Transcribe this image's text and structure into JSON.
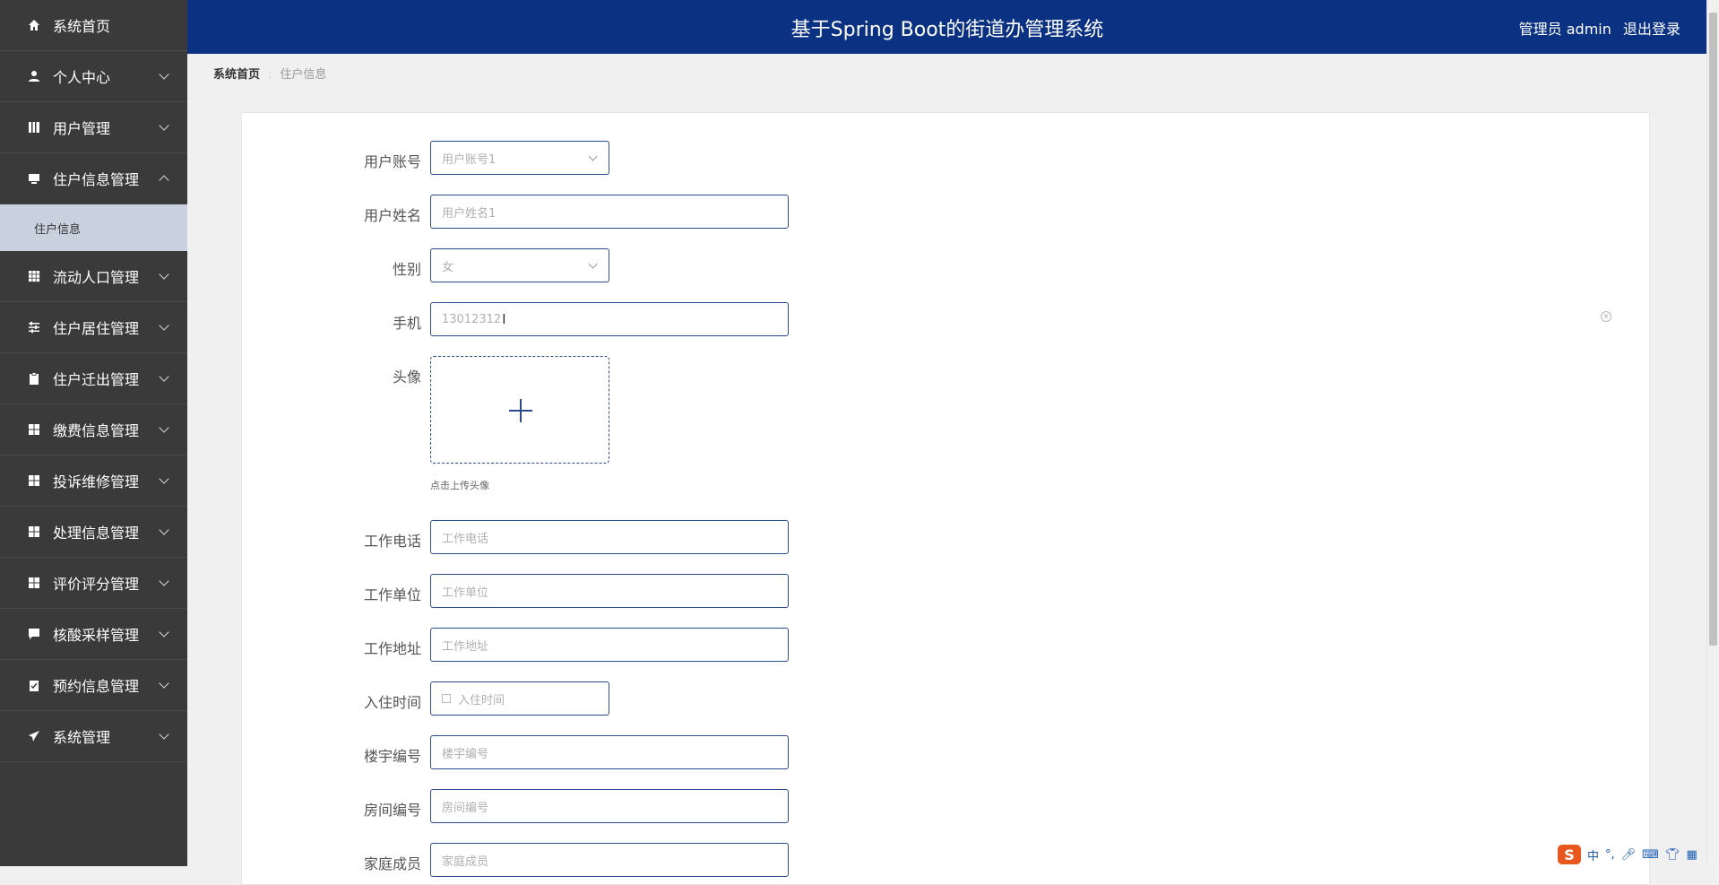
{
  "sidebar": {
    "items": [
      {
        "label": "系统首页",
        "icon": "home-icon"
      },
      {
        "label": "个人中心",
        "icon": "user-icon"
      },
      {
        "label": "用户管理",
        "icon": "book-icon"
      },
      {
        "label": "住户信息管理",
        "icon": "monitor-icon",
        "expanded": true
      },
      {
        "label": "流动人口管理",
        "icon": "grid-icon"
      },
      {
        "label": "住户居住管理",
        "icon": "sliders-icon"
      },
      {
        "label": "住户迁出管理",
        "icon": "clipboard-icon"
      },
      {
        "label": "缴费信息管理",
        "icon": "apps-icon"
      },
      {
        "label": "投诉维修管理",
        "icon": "apps-icon"
      },
      {
        "label": "处理信息管理",
        "icon": "apps-icon"
      },
      {
        "label": "评价评分管理",
        "icon": "apps-icon"
      },
      {
        "label": "核酸采样管理",
        "icon": "comment-icon"
      },
      {
        "label": "预约信息管理",
        "icon": "checklist-icon"
      },
      {
        "label": "系统管理",
        "icon": "send-icon"
      }
    ],
    "submenu": {
      "label": "住户信息"
    }
  },
  "header": {
    "title": "基于Spring Boot的街道办管理系统",
    "user_label": "管理员 admin",
    "logout_label": "退出登录",
    "bg_color": "#0b3182"
  },
  "breadcrumb": {
    "home": "系统首页",
    "current": "住户信息"
  },
  "form": {
    "account": {
      "label": "用户账号",
      "value": "用户账号1"
    },
    "name": {
      "label": "用户姓名",
      "value": "用户姓名1"
    },
    "gender": {
      "label": "性别",
      "value": "女"
    },
    "phone": {
      "label": "手机",
      "value": "13012312"
    },
    "avatar": {
      "label": "头像",
      "tip": "点击上传头像"
    },
    "work_phone": {
      "label": "工作电话",
      "placeholder": "工作电话"
    },
    "work_unit": {
      "label": "工作单位",
      "placeholder": "工作单位"
    },
    "work_address": {
      "label": "工作地址",
      "placeholder": "工作地址"
    },
    "checkin_time": {
      "label": "入住时间",
      "placeholder": "入住时间"
    },
    "building_no": {
      "label": "楼宇编号",
      "placeholder": "楼宇编号"
    },
    "room_no": {
      "label": "房间编号",
      "placeholder": "房间编号"
    },
    "family": {
      "label": "家庭成员",
      "placeholder": "家庭成员"
    }
  },
  "ime": {
    "mode": "中",
    "punct": "°,"
  }
}
